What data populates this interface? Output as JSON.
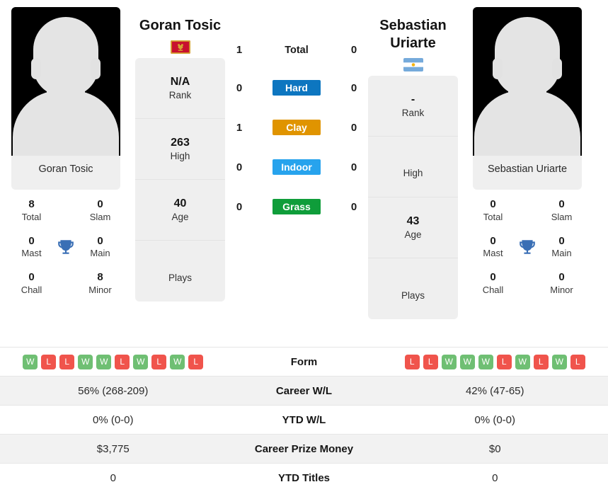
{
  "players": {
    "left": {
      "name": "Goran Tosic",
      "photo_caption": "Goran Tosic",
      "flag": "montenegro-flag",
      "rank": "N/A",
      "rank_label": "Rank",
      "high": "263",
      "high_label": "High",
      "age": "40",
      "age_label": "Age",
      "plays": "",
      "plays_label": "Plays",
      "trophies": {
        "total": "8",
        "total_label": "Total",
        "slam": "0",
        "slam_label": "Slam",
        "mast": "0",
        "mast_label": "Mast",
        "main": "0",
        "main_label": "Main",
        "chall": "0",
        "chall_label": "Chall",
        "minor": "8",
        "minor_label": "Minor"
      },
      "form": [
        "W",
        "L",
        "L",
        "W",
        "W",
        "L",
        "W",
        "L",
        "W",
        "L"
      ],
      "career_wl": "56% (268-209)",
      "ytd_wl": "0% (0-0)",
      "career_prize": "$3,775",
      "ytd_titles": "0"
    },
    "right": {
      "name": "Sebastian Uriarte",
      "photo_caption": "Sebastian Uriarte",
      "flag": "argentina-flag",
      "rank": "-",
      "rank_label": "Rank",
      "high": "",
      "high_label": "High",
      "age": "43",
      "age_label": "Age",
      "plays": "",
      "plays_label": "Plays",
      "trophies": {
        "total": "0",
        "total_label": "Total",
        "slam": "0",
        "slam_label": "Slam",
        "mast": "0",
        "mast_label": "Mast",
        "main": "0",
        "main_label": "Main",
        "chall": "0",
        "chall_label": "Chall",
        "minor": "0",
        "minor_label": "Minor"
      },
      "form": [
        "L",
        "L",
        "W",
        "W",
        "W",
        "L",
        "W",
        "L",
        "W",
        "L"
      ],
      "career_wl": "42% (47-65)",
      "ytd_wl": "0% (0-0)",
      "career_prize": "$0",
      "ytd_titles": "0"
    }
  },
  "head_to_head": [
    {
      "label": "Total",
      "left": "1",
      "right": "0",
      "type": "text"
    },
    {
      "label": "Hard",
      "left": "0",
      "right": "0",
      "type": "badge",
      "color": "#0d76c0"
    },
    {
      "label": "Clay",
      "left": "1",
      "right": "0",
      "type": "badge",
      "color": "#e09400"
    },
    {
      "label": "Indoor",
      "left": "0",
      "right": "0",
      "type": "badge",
      "color": "#27a3ed"
    },
    {
      "label": "Grass",
      "left": "0",
      "right": "0",
      "type": "badge",
      "color": "#0f9d3a"
    }
  ],
  "comparison_rows": [
    {
      "label": "Form",
      "key": "form",
      "striped": false
    },
    {
      "label": "Career W/L",
      "key": "career_wl",
      "striped": true
    },
    {
      "label": "YTD W/L",
      "key": "ytd_wl",
      "striped": false
    },
    {
      "label": "Career Prize Money",
      "key": "career_prize",
      "striped": true
    },
    {
      "label": "YTD Titles",
      "key": "ytd_titles",
      "striped": false
    }
  ],
  "colors": {
    "win": "#6fbf73",
    "loss": "#f0544c",
    "trophy": "#3a6fb5",
    "card_bg": "#efefef"
  }
}
